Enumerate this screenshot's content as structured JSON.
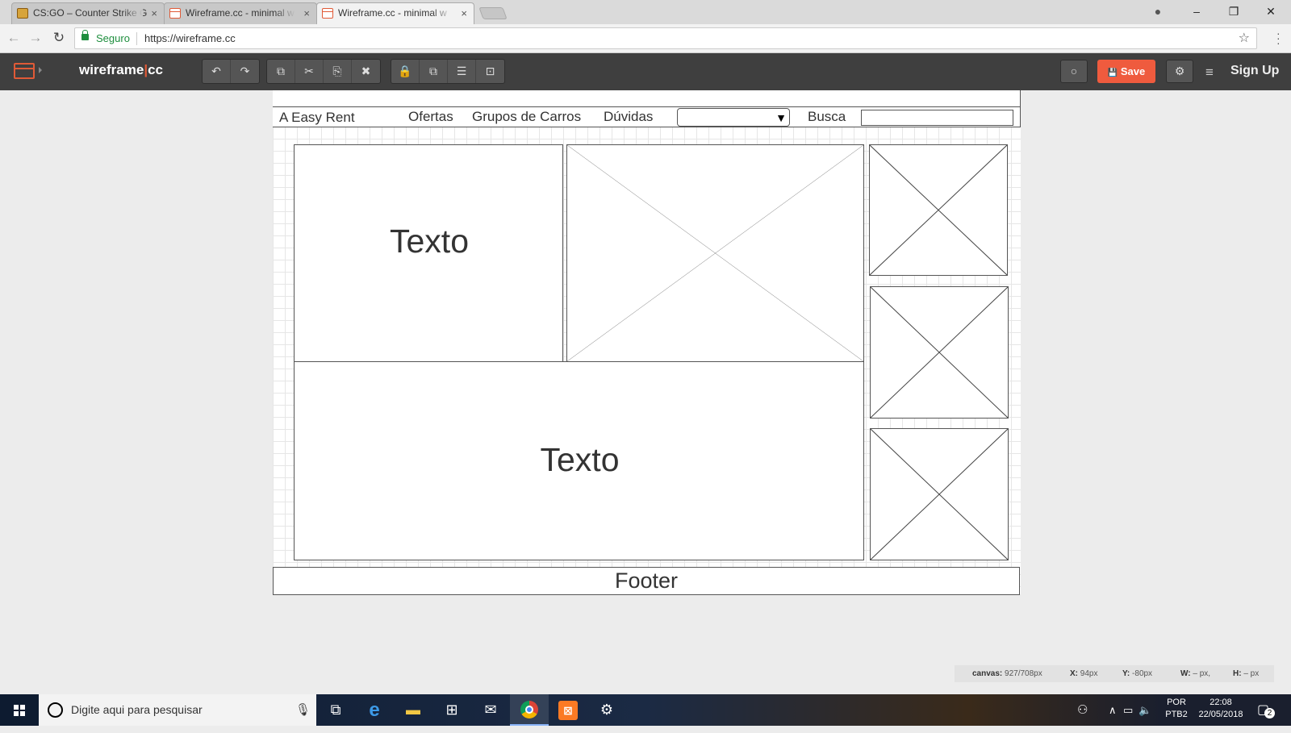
{
  "browser": {
    "tabs": [
      {
        "title": "CS:GO – Counter Strike G",
        "close": "×",
        "active": false
      },
      {
        "title": "Wireframe.cc - minimal w",
        "close": "×",
        "active": false
      },
      {
        "title": "Wireframe.cc - minimal w",
        "close": "×",
        "active": true
      }
    ],
    "window_controls": {
      "minimize": "–",
      "restore": "❐",
      "close": "✕",
      "account": "●"
    },
    "nav": {
      "back": "←",
      "forward": "→",
      "reload": "↻"
    },
    "security_label": "Seguro",
    "url": "https://wireframe.cc",
    "star": "☆"
  },
  "toolbar": {
    "brand_left": "wireframe",
    "brand_sep": "|",
    "brand_right": "cc",
    "history_buttons": [
      "↶",
      "↷"
    ],
    "edit_buttons": [
      "⧉",
      "✂",
      "⎘",
      "✖"
    ],
    "arrange_buttons": [
      "🔒",
      "⧉",
      "☰",
      "⊡"
    ],
    "comment": "○",
    "save_label": "Save",
    "save_icon": "💾",
    "settings": "⚙",
    "menu": "≡",
    "signup_label": "Sign Up"
  },
  "wireframe": {
    "nav": {
      "brand": "A Easy Rent",
      "links": [
        "Ofertas",
        "Grupos de Carros",
        "Dúvidas"
      ],
      "dropdown_arrow": "▼",
      "search_label": "Busca"
    },
    "text_block_1": "Texto",
    "text_block_2": "Texto",
    "footer": "Footer"
  },
  "statusbar": {
    "canvas_label": "canvas:",
    "canvas_value": "927/708px",
    "x_label": "X:",
    "x_value": "94px",
    "y_label": "Y:",
    "y_value": "-80px",
    "w_label": "W:",
    "w_value": "– px,",
    "h_label": "H:",
    "h_value": "– px"
  },
  "taskbar": {
    "search_placeholder": "Digite aqui para pesquisar",
    "language_top": "POR",
    "language_bottom": "PTB2",
    "time": "22:08",
    "date": "22/05/2018",
    "notifications": "2"
  }
}
